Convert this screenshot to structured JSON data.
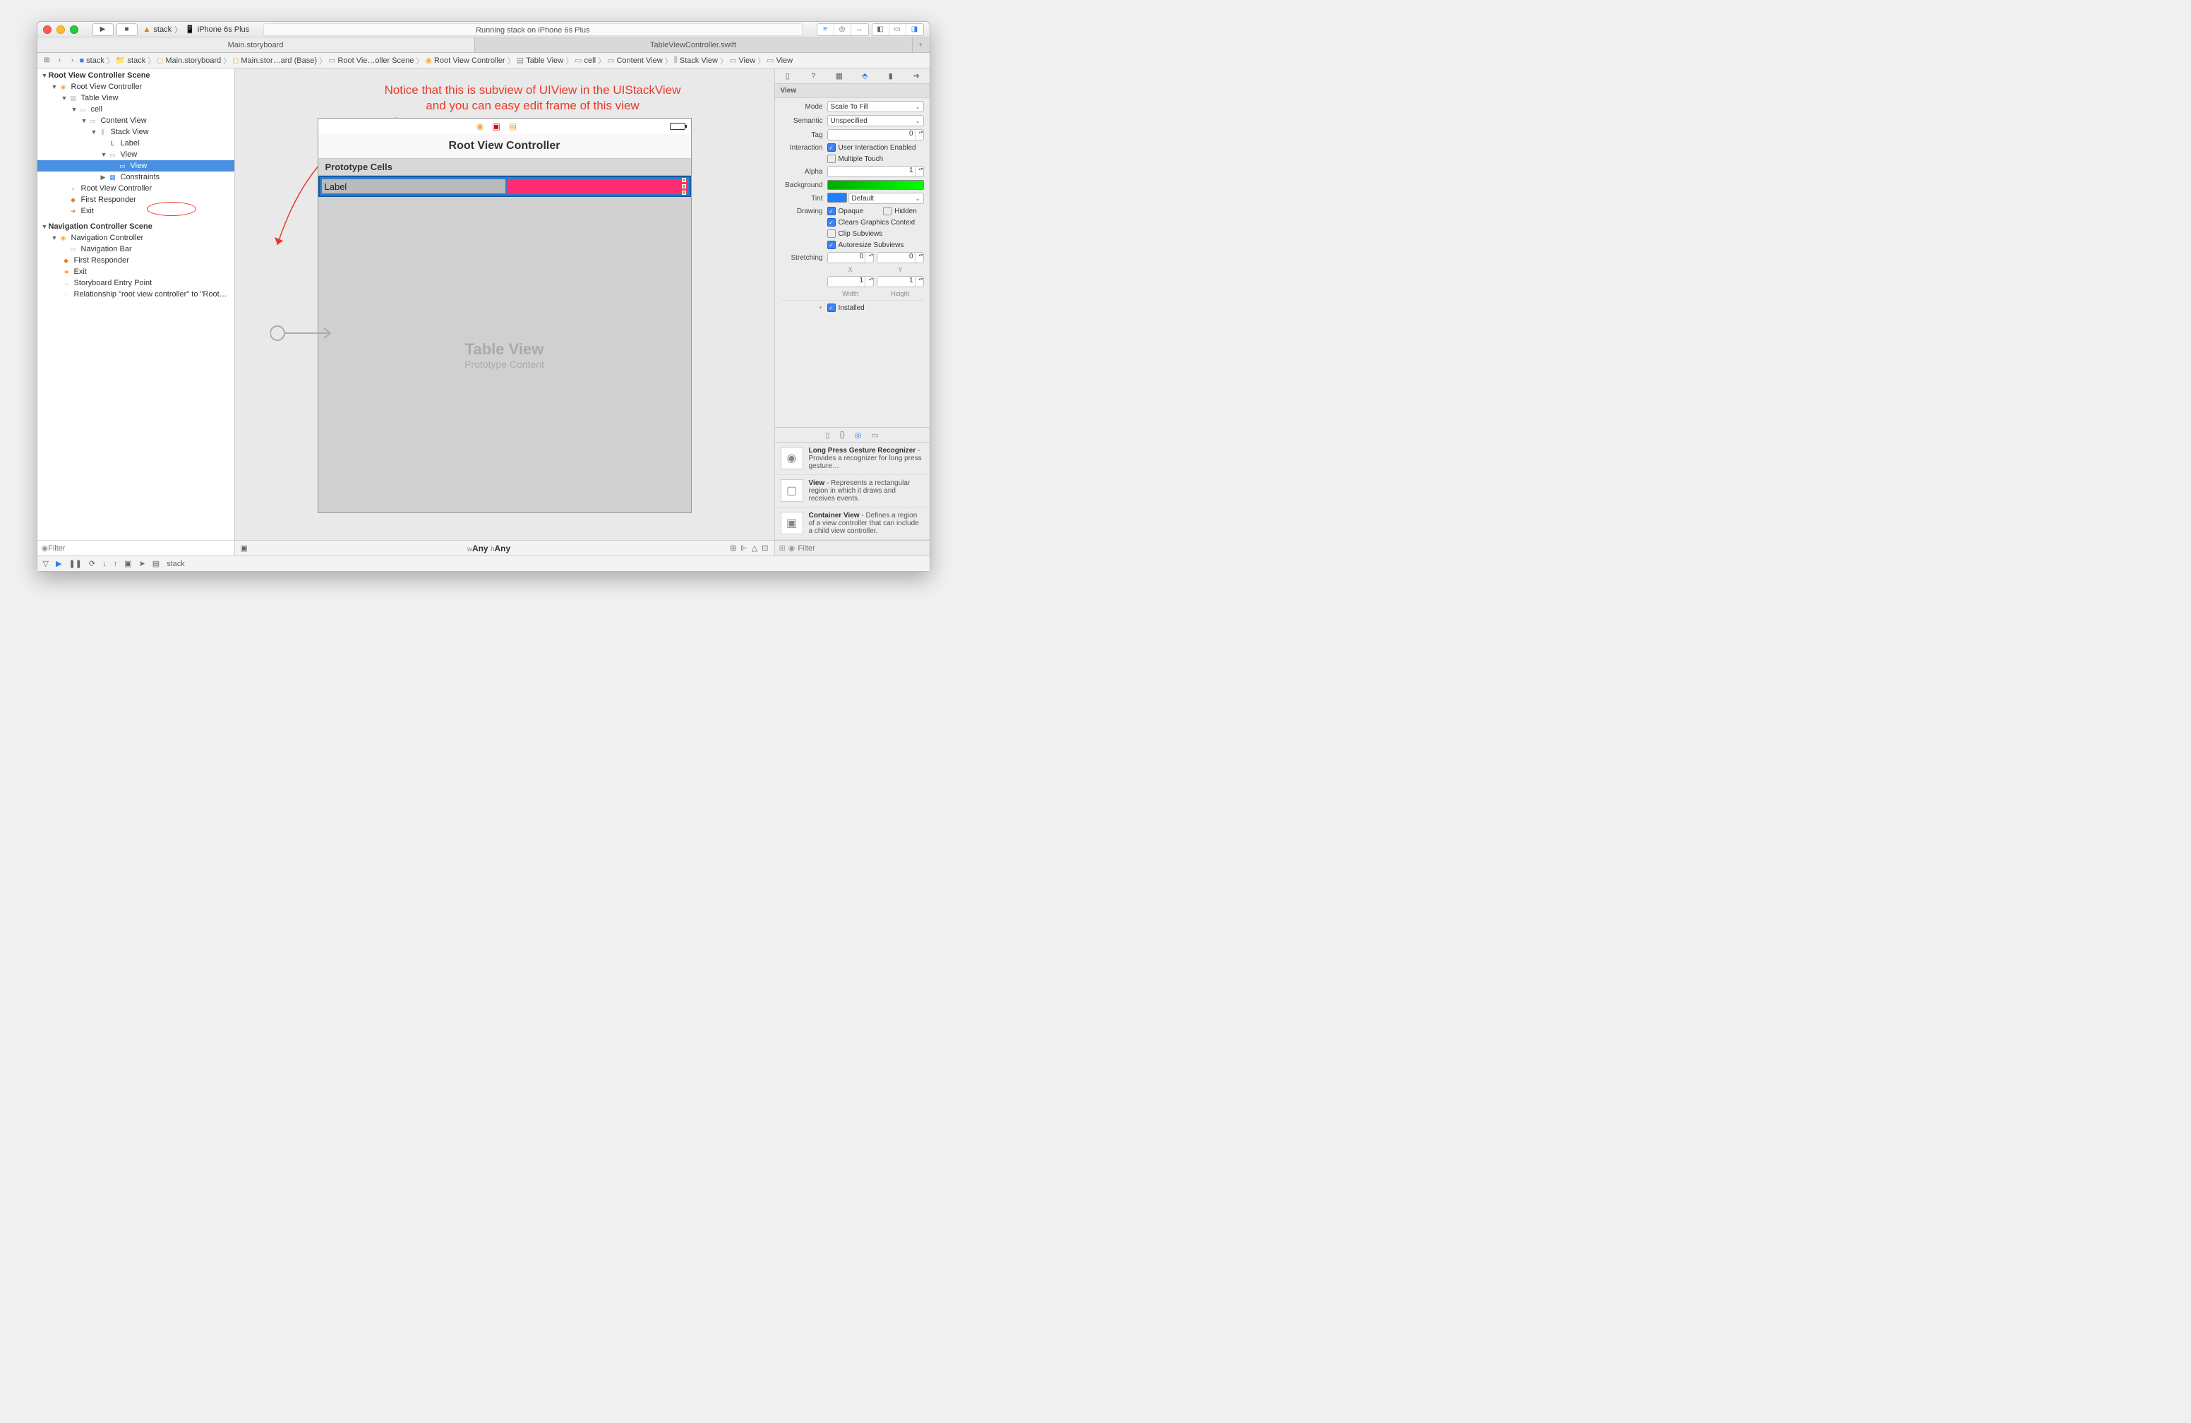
{
  "titlebar": {
    "scheme_app": "stack",
    "scheme_device": "iPhone 6s Plus",
    "status": "Running stack on iPhone 6s Plus"
  },
  "tabs": [
    "Main.storyboard",
    "TableViewController.swift"
  ],
  "pathbar": [
    "stack",
    "stack",
    "Main.storyboard",
    "Main.stor…ard (Base)",
    "Root Vie…oller Scene",
    "Root View Controller",
    "Table View",
    "cell",
    "Content View",
    "Stack View",
    "View",
    "View"
  ],
  "outline": {
    "scene1": "Root View Controller Scene",
    "items1": [
      "Root View Controller",
      "Table View",
      "cell",
      "Content View",
      "Stack View",
      "Label",
      "View",
      "View",
      "Constraints",
      "Root View Controller",
      "First Responder",
      "Exit"
    ],
    "scene2": "Navigation Controller Scene",
    "items2": [
      "Navigation Controller",
      "Navigation Bar",
      "First Responder",
      "Exit",
      "Storyboard Entry Point",
      "Relationship \"root view controller\" to \"Root…"
    ],
    "filter_placeholder": "Filter"
  },
  "annotation": {
    "line1": "Notice that this is subview of UIView in the UIStackView",
    "line2": "and you can easy edit frame of this view"
  },
  "canvas": {
    "nav_title": "Root View Controller",
    "proto_header": "Prototype Cells",
    "label_text": "Label",
    "tv_title": "Table View",
    "tv_sub": "Prototype Content",
    "size_class_w": "Any",
    "size_class_h": "Any"
  },
  "inspector": {
    "header": "View",
    "mode": "Scale To Fill",
    "semantic": "Unspecified",
    "tag": "0",
    "interaction_label": "Interaction",
    "user_interaction": "User Interaction Enabled",
    "multiple_touch": "Multiple Touch",
    "alpha": "1",
    "background_label": "Background",
    "tint": "Default",
    "drawing_label": "Drawing",
    "opaque": "Opaque",
    "hidden": "Hidden",
    "clears": "Clears Graphics Context",
    "clip": "Clip Subviews",
    "autoresize": "Autoresize Subviews",
    "stretching_label": "Stretching",
    "stretch_x": "0",
    "stretch_y": "0",
    "stretch_w": "1",
    "stretch_h": "1",
    "x_lbl": "X",
    "y_lbl": "Y",
    "w_lbl": "Width",
    "h_lbl": "Height",
    "installed": "Installed",
    "mode_lbl": "Mode",
    "semantic_lbl": "Semantic",
    "tag_lbl": "Tag",
    "alpha_lbl": "Alpha",
    "tint_lbl": "Tint"
  },
  "library": {
    "items": [
      {
        "title": "Long Press Gesture Recognizer",
        "desc": " - Provides a recognizer for long press gesture…"
      },
      {
        "title": "View",
        "desc": " - Represents a rectangular region in which it draws and receives events."
      },
      {
        "title": "Container View",
        "desc": " - Defines a region of a view controller that can include a child view controller."
      }
    ],
    "filter_placeholder": "Filter"
  },
  "debugbar": {
    "process": "stack"
  }
}
